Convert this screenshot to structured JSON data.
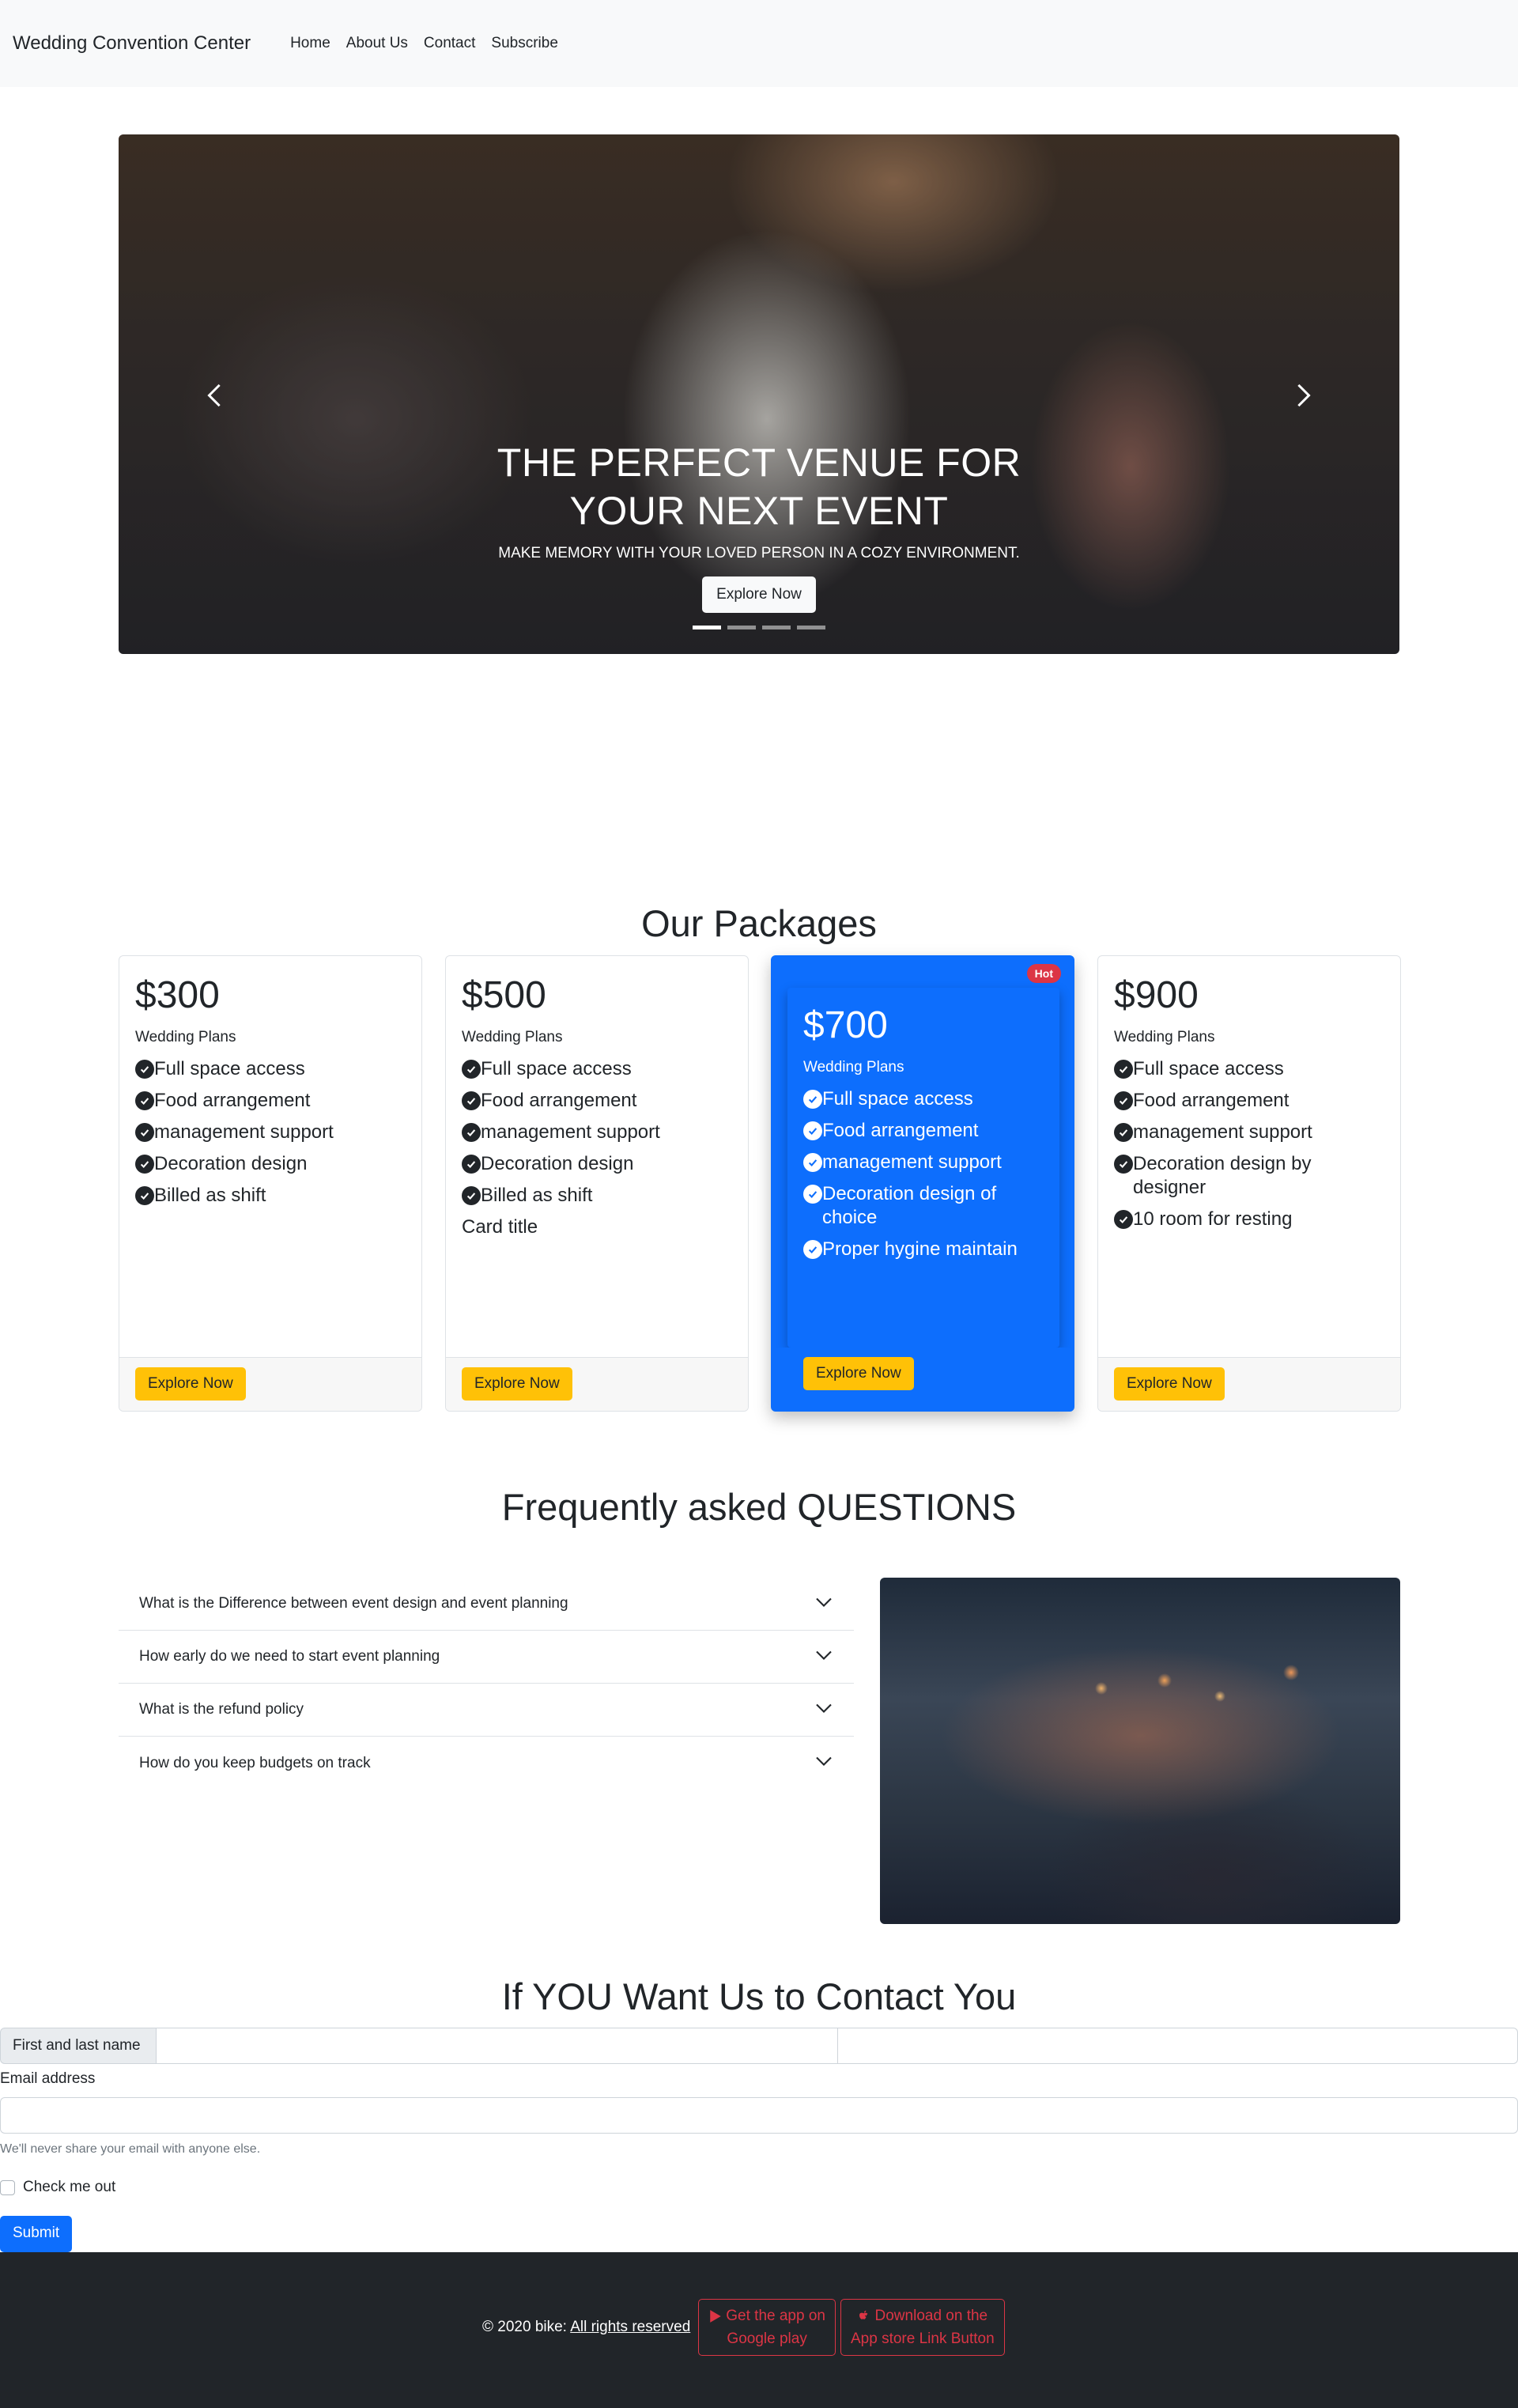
{
  "navbar": {
    "brand": "Wedding Convention Center",
    "links": [
      "Home",
      "About Us",
      "Contact",
      "Subscribe"
    ]
  },
  "carousel": {
    "title": "THE PERFECT VENUE FOR YOUR NEXT EVENT",
    "subtitle": "MAKE MEMORY WITH YOUR LOVED PERSON IN A COZY ENVIRONMENT.",
    "button": "Explore Now",
    "slide_count": 4,
    "active_slide": 1
  },
  "packages": {
    "title": "Our Packages",
    "cards": [
      {
        "price": "$300",
        "subtitle": "Wedding Plans",
        "features": [
          "Full space access",
          "Food arrangement",
          "management support",
          "Decoration design",
          "Billed as shift"
        ],
        "extra": "",
        "button": "Explore Now"
      },
      {
        "price": "$500",
        "subtitle": "Wedding Plans",
        "features": [
          "Full space access",
          "Food arrangement",
          "management support",
          "Decoration design",
          "Billed as shift"
        ],
        "extra": "Card title",
        "button": "Explore Now"
      },
      {
        "price": "$700",
        "subtitle": "Wedding Plans",
        "badge": "Hot",
        "features": [
          "Full space access",
          "Food arrangement",
          "management support",
          "Decoration design of choice",
          "Proper hygine maintain"
        ],
        "extra": "",
        "button": "Explore Now"
      },
      {
        "price": "$900",
        "subtitle": "Wedding Plans",
        "features": [
          "Full space access",
          "Food arrangement",
          "management support",
          "Decoration design by designer",
          "10 room for resting"
        ],
        "extra": "",
        "button": "Explore Now"
      }
    ]
  },
  "faq": {
    "title": "Frequently asked QUESTIONS",
    "items": [
      "What is the Difference between event design and event planning",
      "How early do we need to start event planning",
      "What is the refund policy",
      "How do you keep budgets on track"
    ]
  },
  "contact": {
    "title": "If YOU Want Us to Contact You",
    "name_label": "First and last name",
    "first_value": "",
    "last_value": "",
    "email_label": "Email address",
    "email_value": "",
    "email_help": "We'll never share your email with anyone else.",
    "checkbox_label": "Check me out",
    "submit": "Submit"
  },
  "footer": {
    "copyright": "© 2020 bike: ",
    "rights": "All rights reserved",
    "google_line1": "Get the app on",
    "google_line2": "Google play",
    "apple_line1": "Download on the",
    "apple_line2": "App store Link Button"
  },
  "colors": {
    "primary": "#0d6efd",
    "warning": "#ffc107",
    "danger": "#dc3545",
    "footer_bg": "#212529"
  }
}
